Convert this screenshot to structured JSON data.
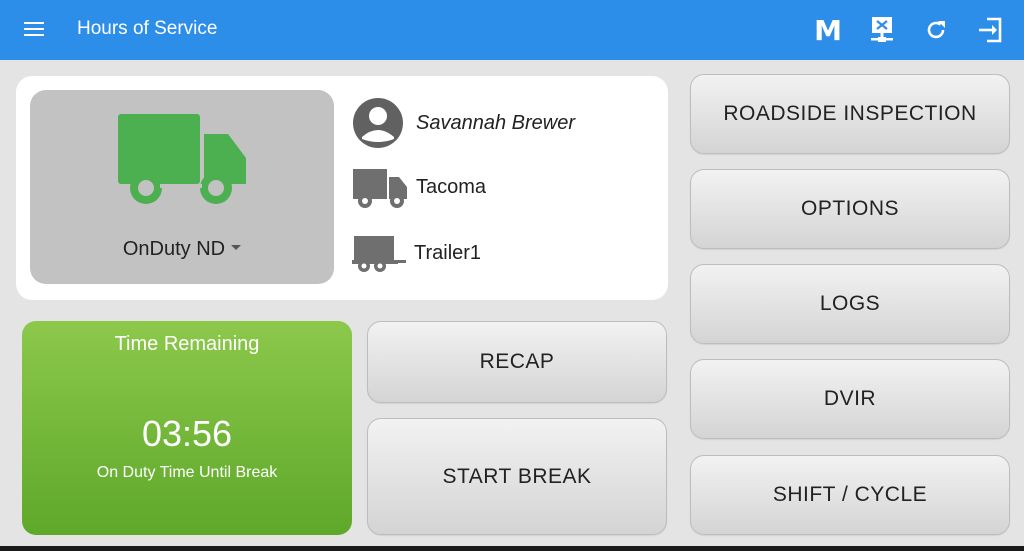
{
  "appbar": {
    "title": "Hours of Service",
    "m_label": "M",
    "bg_color": "#2c8ee8"
  },
  "status": {
    "label": "OnDuty ND",
    "truck_color": "#4caf50"
  },
  "info": {
    "driver_name": "Savannah Brewer",
    "vehicle": "Tacoma",
    "trailer": "Trailer1"
  },
  "timer": {
    "title": "Time Remaining",
    "value": "03:56",
    "subtitle": "On Duty Time Until Break"
  },
  "buttons": {
    "recap": "RECAP",
    "start_break": "START BREAK",
    "roadside_inspection": "ROADSIDE INSPECTION",
    "options": "OPTIONS",
    "logs": "LOGS",
    "dvir": "DVIR",
    "shift_cycle": "SHIFT / CYCLE"
  },
  "icons": [
    "menu-icon",
    "m-icon",
    "network-icon",
    "refresh-icon",
    "logout-icon",
    "truck-icon",
    "user-icon",
    "vehicle-icon",
    "trailer-icon",
    "dropdown-caret-icon"
  ]
}
